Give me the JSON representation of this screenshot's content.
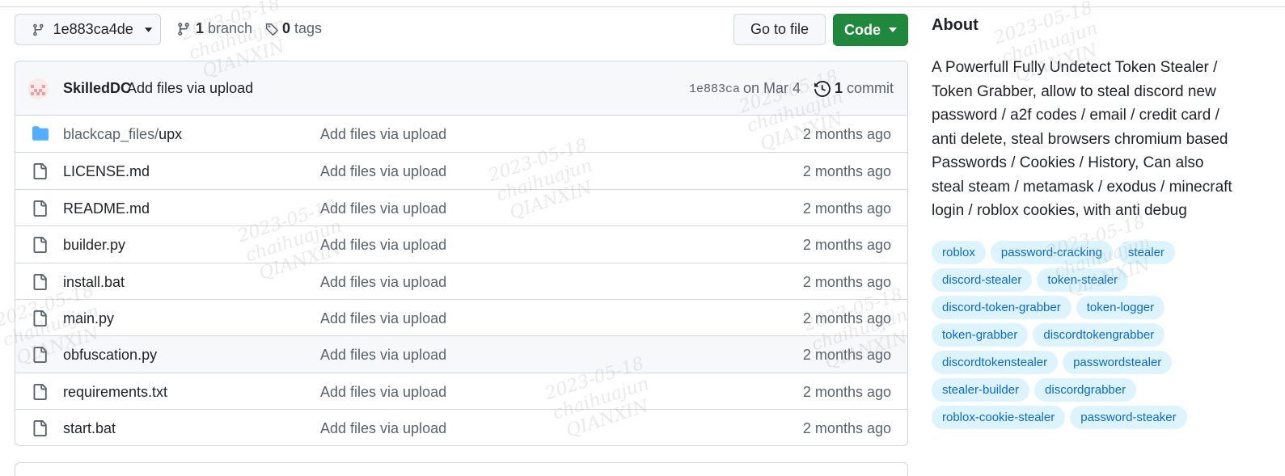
{
  "toolbar": {
    "branch_name": "1e883ca4de",
    "branch_count": "1",
    "branch_label": "branch",
    "tag_count": "0",
    "tag_label": "tags",
    "goto_label": "Go to file",
    "code_label": "Code"
  },
  "commit": {
    "author": "SkilledDC",
    "message": "Add files via upload",
    "sha": "1e883ca",
    "date": "on Mar 4",
    "count": "1",
    "count_label": "commit"
  },
  "files": [
    {
      "dir": "blackcap_files/",
      "name": "upx",
      "type": "folder",
      "message": "Add files via upload",
      "age": "2 months ago"
    },
    {
      "dir": "",
      "name": "LICENSE.md",
      "type": "file",
      "message": "Add files via upload",
      "age": "2 months ago"
    },
    {
      "dir": "",
      "name": "README.md",
      "type": "file",
      "message": "Add files via upload",
      "age": "2 months ago"
    },
    {
      "dir": "",
      "name": "builder.py",
      "type": "file",
      "message": "Add files via upload",
      "age": "2 months ago"
    },
    {
      "dir": "",
      "name": "install.bat",
      "type": "file",
      "message": "Add files via upload",
      "age": "2 months ago"
    },
    {
      "dir": "",
      "name": "main.py",
      "type": "file",
      "message": "Add files via upload",
      "age": "2 months ago"
    },
    {
      "dir": "",
      "name": "obfuscation.py",
      "type": "file",
      "message": "Add files via upload",
      "age": "2 months ago"
    },
    {
      "dir": "",
      "name": "requirements.txt",
      "type": "file",
      "message": "Add files via upload",
      "age": "2 months ago"
    },
    {
      "dir": "",
      "name": "start.bat",
      "type": "file",
      "message": "Add files via upload",
      "age": "2 months ago"
    }
  ],
  "about": {
    "title": "About",
    "description": "A Powerfull Fully Undetect Token Stealer / Token Grabber, allow to steal discord new password / a2f codes / email / credit card / anti delete, steal browsers chromium based Passwords / Cookies / History, Can also steal steam / metamask / exodus / minecraft login / roblox cookies, with anti debug",
    "topics": [
      "roblox",
      "password-cracking",
      "stealer",
      "discord-stealer",
      "token-stealer",
      "discord-token-grabber",
      "token-logger",
      "token-grabber",
      "discordtokengrabber",
      "discordtokenstealer",
      "passwordstealer",
      "stealer-builder",
      "discordgrabber",
      "roblox-cookie-stealer",
      "password-steaker"
    ]
  },
  "watermark": {
    "date": "2023-05-18",
    "user": "chaihuajun",
    "org": "QIANXIN"
  },
  "colors": {
    "accent_green": "#1f883d",
    "link_blue": "#0969da",
    "topic_bg": "#ddf4ff",
    "folder_blue": "#54aeff"
  }
}
